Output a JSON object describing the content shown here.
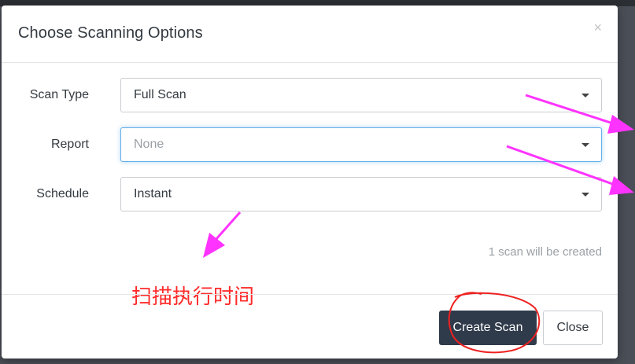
{
  "modal": {
    "title": "Choose Scanning Options",
    "close_glyph": "×"
  },
  "form": {
    "fields": [
      {
        "label": "Scan Type",
        "value": "Full Scan",
        "placeholder": false,
        "focused": false
      },
      {
        "label": "Report",
        "value": "None",
        "placeholder": true,
        "focused": true
      },
      {
        "label": "Schedule",
        "value": "Instant",
        "placeholder": false,
        "focused": false
      }
    ],
    "hint": "1 scan will be created"
  },
  "annotation": {
    "text": "扫描执行时间",
    "color": "#ff2a2a",
    "arrow_color": "#ff33ff"
  },
  "footer": {
    "create_label": "Create Scan",
    "close_label": "Close"
  },
  "colors": {
    "primary_button": "#2f3a4a",
    "focus_border": "#66afe9"
  }
}
